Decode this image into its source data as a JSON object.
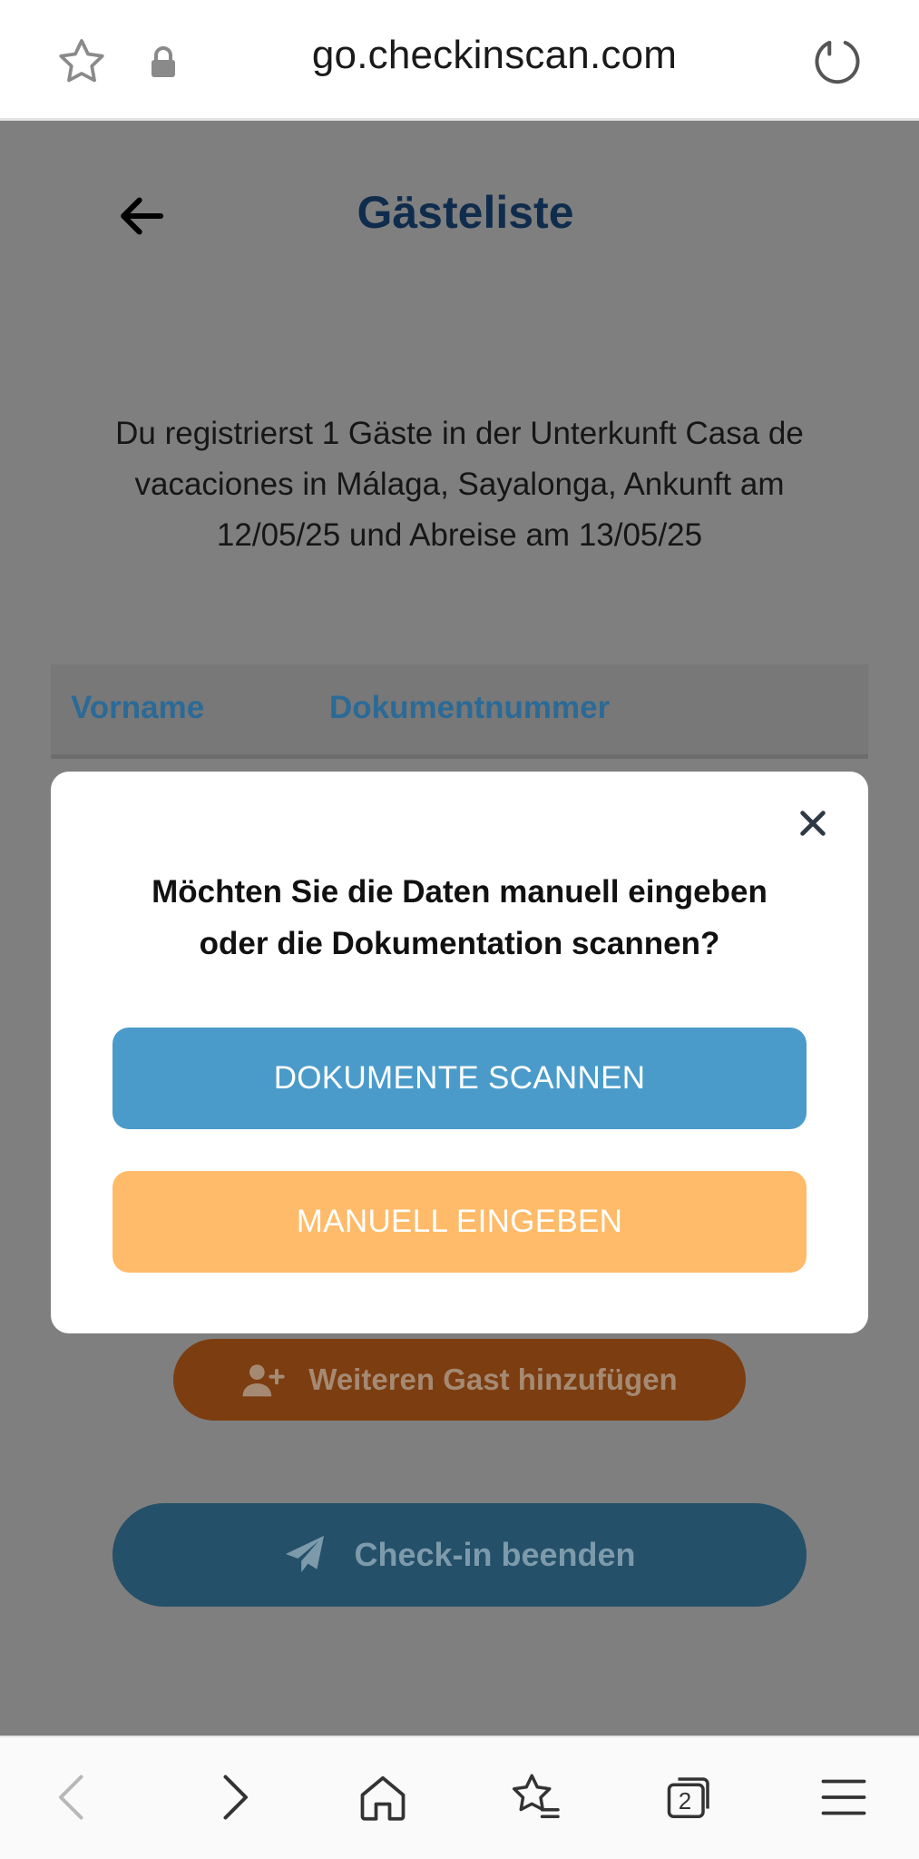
{
  "browser": {
    "url": "go.checkinscan.com",
    "tab_count": "2"
  },
  "page": {
    "title": "Gästeliste",
    "intro": "Du registrierst 1 Gäste in der Unterkunft Casa de vacaciones in Málaga, Sayalonga, Ankunft am 12/05/25 und Abreise am 13/05/25",
    "table": {
      "columns": [
        "Vorname",
        "Dokumentnummer"
      ]
    },
    "add_guest_label": "Weiteren Gast hinzufügen",
    "checkin_label": "Check-in beenden"
  },
  "modal": {
    "question_line1": "Möchten Sie die Daten manuell eingeben",
    "question_line2": "oder die Dokumentation scannen?",
    "scan_label": "DOKUMENTE SCANNEN",
    "manual_label": "MANUELL EINGEBEN"
  },
  "colors": {
    "title": "#102c4d",
    "scan_button": "#4a9bca",
    "manual_button": "#ffbb69",
    "overlay": "#7f7f7f"
  }
}
